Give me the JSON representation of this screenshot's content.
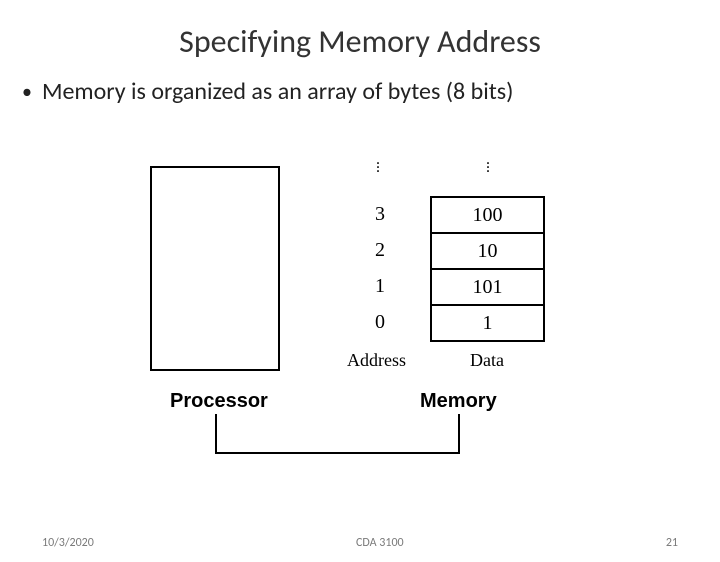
{
  "title": "Specifying Memory Address",
  "bullet": "Memory is organized as an array of bytes (8 bits)",
  "diagram": {
    "addresses": [
      "3",
      "2",
      "1",
      "0"
    ],
    "data": [
      "100",
      "10",
      "101",
      "1"
    ],
    "col_address_label": "Address",
    "col_data_label": "Data",
    "processor_label": "Processor",
    "memory_label": "Memory"
  },
  "footer": {
    "date": "10/3/2020",
    "course": "CDA 3100",
    "page": "21"
  }
}
